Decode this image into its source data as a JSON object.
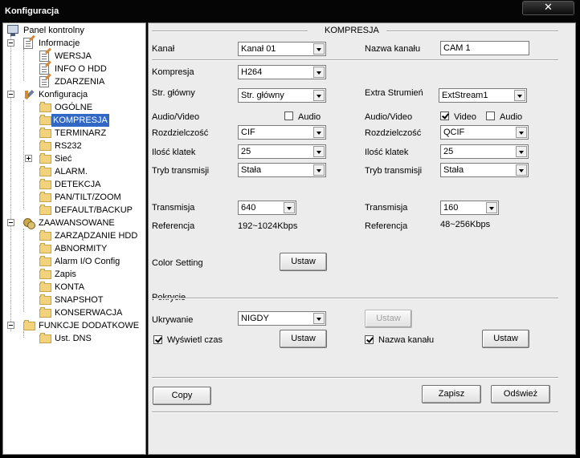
{
  "window": {
    "title": "Konfiguracja"
  },
  "tree": {
    "root": "Panel kontrolny",
    "informacje": "Informacje",
    "wersja": "WERSJA",
    "info_hdd": "INFO O HDD",
    "zdarzenia": "ZDARZENIA",
    "konfiguracja": "Konfiguracja",
    "ogolne": "OGÓLNE",
    "kompresja": "KOMPRESJA",
    "terminarz": "TERMINARZ",
    "rs232": "RS232",
    "siec": "Sieć",
    "alarm": "ALARM.",
    "detekcja": "DETEKCJA",
    "pan_tilt_zoom": "PAN/TILT/ZOOM",
    "default_backup": "DEFAULT/BACKUP",
    "zaawansowane": "ZAAWANSOWANE",
    "zarzadzanie_hdd": "ZARZĄDZANIE HDD",
    "abnormity": "ABNORMITY",
    "alarm_io": "Alarm I/O Config",
    "zapis": "Zapis",
    "konta": "KONTA",
    "snapshot": "SNAPSHOT",
    "konserwacja": "KONSERWACJA",
    "funkcje": "FUNKCJE DODATKOWE",
    "ust_dns": "Ust. DNS"
  },
  "section_title": "KOMPRESJA",
  "kanal": {
    "label": "Kanał",
    "value": "Kanał 01"
  },
  "nazwa_kanalu": {
    "label": "Nazwa kanału",
    "value": "CAM 1"
  },
  "kompresja": {
    "label": "Kompresja",
    "value": "H264"
  },
  "str_glowny": {
    "label": "Str. główny",
    "value": "Str. główny"
  },
  "extra_strumien": {
    "label": "Extra Strumień",
    "value": "ExtStream1"
  },
  "main_stream": {
    "audio_video_label": "Audio/Video",
    "audio_label": "Audio",
    "audio_checked": false,
    "res_label": "Rozdzielczość",
    "res_value": "CIF",
    "fps_label": "Ilość klatek",
    "fps_value": "25",
    "mode_label": "Tryb transmisji",
    "mode_value": "Stała",
    "bitrate_label": "Transmisja",
    "bitrate_value": "640",
    "ref_label": "Referencja",
    "ref_value": "192~1024Kbps"
  },
  "extra_stream": {
    "audio_video_label": "Audio/Video",
    "video_label": "Video",
    "video_checked": true,
    "audio_label": "Audio",
    "audio_checked": false,
    "res_label": "Rozdzielczość",
    "res_value": "QCIF",
    "fps_label": "Ilość klatek",
    "fps_value": "25",
    "mode_label": "Tryb transmisji",
    "mode_value": "Stała",
    "bitrate_label": "Transmisja",
    "bitrate_value": "160",
    "ref_label": "Referencja",
    "ref_value": "48~256Kbps"
  },
  "color_setting": {
    "label": "Color Setting",
    "button": "Ustaw"
  },
  "pokrycie": {
    "label": "Pokrycie",
    "ukrywanie_label": "Ukrywanie",
    "ukrywanie_value": "NIGDY",
    "ukrywanie_button": "Ustaw",
    "wyswietl_czas_label": "Wyświetl czas",
    "wyswietl_czas_checked": true,
    "wyswietl_czas_button": "Ustaw",
    "nazwa_kanalu_label": "Nazwa kanału",
    "nazwa_kanalu_checked": true,
    "nazwa_kanalu_button": "Ustaw"
  },
  "buttons": {
    "copy": "Copy",
    "zapisz": "Zapisz",
    "odswiez": "Odśwież"
  }
}
